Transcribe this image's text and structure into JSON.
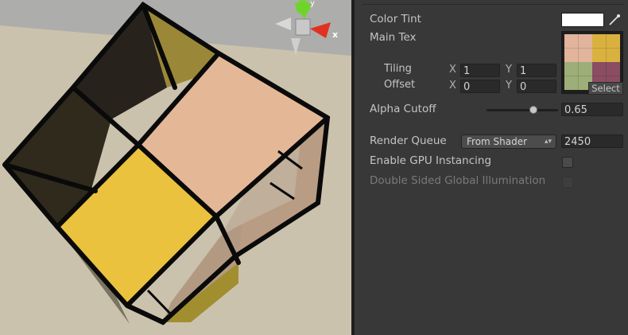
{
  "scene": {
    "gizmo": {
      "y_label": "y",
      "x_label": "x"
    }
  },
  "inspector": {
    "color_tint": {
      "label": "Color Tint",
      "value": "#ffffff"
    },
    "main_tex": {
      "label": "Main Tex",
      "select_label": "Select",
      "tiling": {
        "label": "Tiling",
        "x_label": "X",
        "x": "1",
        "y_label": "Y",
        "y": "1"
      },
      "offset": {
        "label": "Offset",
        "x_label": "X",
        "x": "0",
        "y_label": "Y",
        "y": "0"
      }
    },
    "alpha_cutoff": {
      "label": "Alpha Cutoff",
      "value": "0.65",
      "slider_fraction": 0.65
    },
    "render_queue": {
      "label": "Render Queue",
      "option": "From Shader",
      "value": "2450"
    },
    "gpu_instancing": {
      "label": "Enable GPU Instancing",
      "checked": false
    },
    "double_sided_gi": {
      "label": "Double Sided Global Illumination",
      "checked": false,
      "disabled": true
    }
  }
}
